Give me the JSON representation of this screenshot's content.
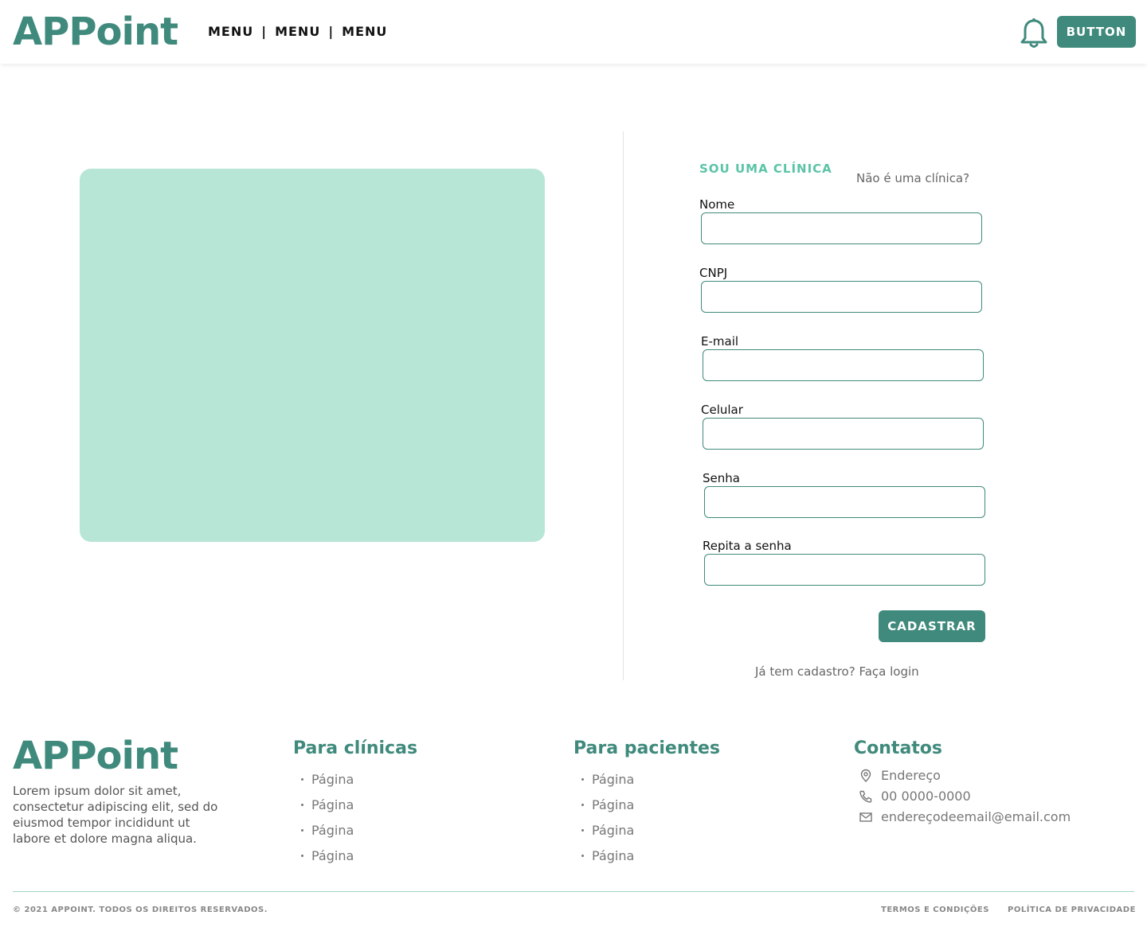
{
  "header": {
    "logo": "APPoint",
    "menu": [
      "MENU",
      "MENU",
      "MENU"
    ],
    "separator": "|",
    "button_label": "BUTTON",
    "bell_icon": "bell-icon"
  },
  "form": {
    "title": "SOU UMA CLÍNICA",
    "alt_link": "Não é uma clínica?",
    "fields": [
      {
        "label": "Nome",
        "value": ""
      },
      {
        "label": "CNPJ",
        "value": ""
      },
      {
        "label": "E-mail",
        "value": ""
      },
      {
        "label": "Celular",
        "value": ""
      },
      {
        "label": "Senha",
        "value": ""
      },
      {
        "label": "Repita a senha",
        "value": ""
      }
    ],
    "submit_label": "CADASTRAR",
    "login_link": "Já tem cadastro? Faça login"
  },
  "footer": {
    "logo": "APPoint",
    "description": "Lorem ipsum dolor sit amet, consectetur adipiscing elit, sed do eiusmod tempor incididunt ut labore et dolore magna aliqua.",
    "clinics": {
      "title": "Para clínicas",
      "items": [
        "Página",
        "Página",
        "Página",
        "Página"
      ]
    },
    "patients": {
      "title": "Para pacientes",
      "items": [
        "Página",
        "Página",
        "Página",
        "Página"
      ]
    },
    "contacts": {
      "title": "Contatos",
      "address": "Endereço",
      "phone": "00 0000-0000",
      "email": "endereçodeemail@email.com"
    },
    "copyright": "© 2021 APPOINT. TODOS OS DIREITOS RESERVADOS.",
    "terms": "TERMOS E CONDIÇÕES",
    "privacy": "POLÍTICA DE PRIVACIDADE"
  },
  "colors": {
    "brand": "#3f8a7c",
    "accent": "#5bc4a7",
    "image_placeholder": "#b8e6d6"
  }
}
